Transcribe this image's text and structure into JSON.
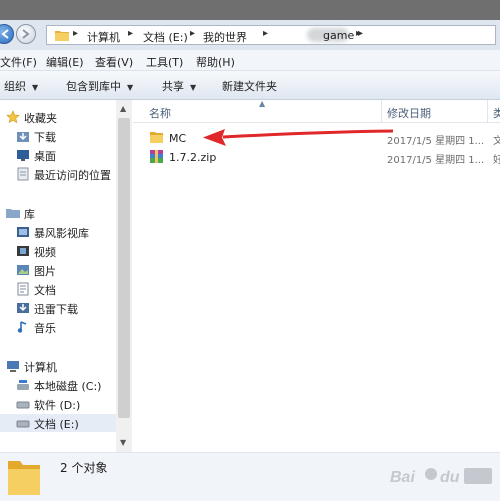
{
  "address_bar": {
    "crumbs": [
      "计算机",
      "文档 (E:)",
      "我的世界",
      "game"
    ]
  },
  "menu": {
    "items": [
      "文件(F)",
      "编辑(E)",
      "查看(V)",
      "工具(T)",
      "帮助(H)"
    ]
  },
  "toolbar": {
    "organize": "组织",
    "include_in_library": "包含到库中",
    "share": "共享",
    "new_folder": "新建文件夹"
  },
  "nav": {
    "favorites": {
      "label": "收藏夹",
      "items": [
        "下载",
        "桌面",
        "最近访问的位置"
      ]
    },
    "libraries": {
      "label": "库",
      "items": [
        "暴风影视库",
        "视频",
        "图片",
        "文档",
        "迅雷下载",
        "音乐"
      ]
    },
    "computer": {
      "label": "计算机",
      "items": [
        "本地磁盘 (C:)",
        "软件 (D:)",
        "文档 (E:)"
      ]
    }
  },
  "columns": {
    "name": "名称",
    "date_modified": "修改日期",
    "type_partial": "类"
  },
  "files": [
    {
      "name": "MC",
      "date": "2017/1/5 星期四 1...",
      "type": "文"
    },
    {
      "name": "1.7.2.zip",
      "date": "2017/1/5 星期四 1...",
      "type": "好"
    }
  ],
  "status": {
    "text": "2 个对象"
  },
  "watermark": {
    "text": "Bai du 经验"
  },
  "colors": {
    "annotation_arrow": "#e0282a",
    "folder": "#f2c14e",
    "selection": "#e5ecf6"
  }
}
